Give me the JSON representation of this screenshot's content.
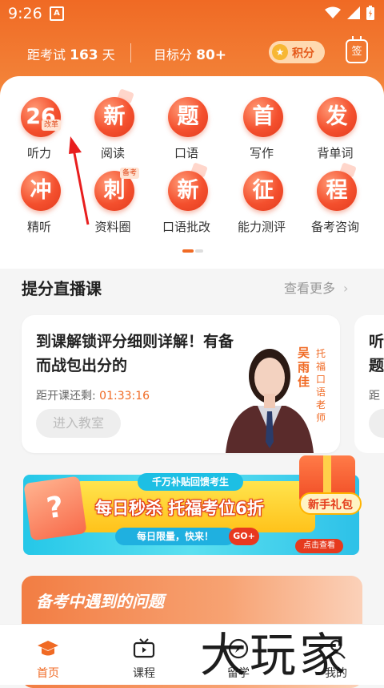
{
  "status_bar": {
    "time": "9:26",
    "notif_icon": "A"
  },
  "header": {
    "days_prefix": "距考试",
    "days_value": "163",
    "days_suffix": "天",
    "target_prefix": "目标分",
    "target_value": "80+",
    "points_label": "积分",
    "checkin_label": "签"
  },
  "grid": [
    {
      "icon_text": "26",
      "badge": "改革",
      "label": "听力"
    },
    {
      "icon_text": "新",
      "label": "阅读"
    },
    {
      "icon_text": "题",
      "label": "口语"
    },
    {
      "icon_text": "首",
      "label": "写作"
    },
    {
      "icon_text": "发",
      "label": "背单词"
    },
    {
      "icon_text": "冲",
      "label": "精听"
    },
    {
      "icon_text": "刺",
      "badge": "备考",
      "label": "资料圈"
    },
    {
      "icon_text": "新",
      "label": "口语批改"
    },
    {
      "icon_text": "征",
      "label": "能力测评"
    },
    {
      "icon_text": "程",
      "label": "备考咨询"
    }
  ],
  "live_section": {
    "title": "提分直播课",
    "more": "查看更多",
    "card": {
      "title": "到课解锁评分细则详解！有备而战包出分的",
      "countdown_label": "距开课还剩:",
      "countdown_value": "01:33:16",
      "enter_button": "进入教室",
      "teacher_name": "吴雨佳",
      "teacher_role": "托福口语老师"
    },
    "card2": {
      "title": "听题",
      "sub": "距"
    }
  },
  "banner": {
    "top": "千万补贴回馈考生",
    "main": "每日秒杀 托福考位6折",
    "sub": "每日限量，快来！",
    "go": "GO+",
    "gift": "新手礼包",
    "gift_sub": "点击查看"
  },
  "problems": {
    "title": "备考中遇到的问题"
  },
  "tabbar": [
    {
      "label": "首页",
      "icon": "graduation-cap-icon"
    },
    {
      "label": "课程",
      "icon": "tv-icon"
    },
    {
      "label": "留学",
      "icon": "compass-icon"
    },
    {
      "label": "我的",
      "icon": "user-icon"
    }
  ],
  "watermark": "大玩家",
  "colors": {
    "brand": "#f06a24",
    "header_bg": "#f27d34"
  }
}
